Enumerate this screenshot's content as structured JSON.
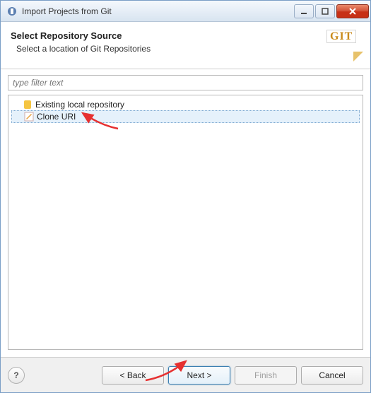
{
  "window": {
    "title": "Import Projects from Git"
  },
  "header": {
    "title": "Select Repository Source",
    "subtitle": "Select a location of Git Repositories",
    "badge": "GIT"
  },
  "filter": {
    "placeholder": "type filter text"
  },
  "tree": {
    "items": [
      {
        "label": "Existing local repository",
        "icon": "db-icon",
        "selected": false
      },
      {
        "label": "Clone URI",
        "icon": "edit-icon",
        "selected": true
      }
    ]
  },
  "buttons": {
    "back": "< Back",
    "next": "Next >",
    "finish": "Finish",
    "cancel": "Cancel"
  }
}
